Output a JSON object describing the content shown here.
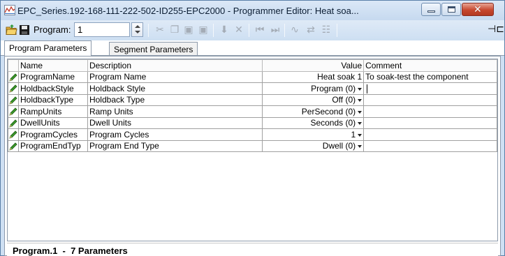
{
  "window": {
    "title": "EPC_Series.192-168-111-222-502-ID255-EPC2000 - Programmer Editor: Heat soa..."
  },
  "toolbar": {
    "program_label": "Program:",
    "program_value": "1",
    "icons": [
      "open-folder-icon",
      "save-icon",
      "cut-icon",
      "copy-icon",
      "paste-icon",
      "paste-special-icon",
      "insert-icon",
      "delete-icon",
      "first-icon",
      "last-icon",
      "graph-icon",
      "sync-icon",
      "table-icon",
      "pin-icon"
    ]
  },
  "tabs": [
    {
      "label": "Program Parameters",
      "active": true
    },
    {
      "label": "Segment Parameters",
      "active": false
    }
  ],
  "grid": {
    "columns": {
      "name": "Name",
      "description": "Description",
      "value": "Value",
      "comment": "Comment"
    },
    "rows": [
      {
        "name": "ProgramName",
        "description": "Program Name",
        "value": "Heat soak 1",
        "dropdown": false,
        "comment": "To soak-test the component"
      },
      {
        "name": "HoldbackStyle",
        "description": "Holdback Style",
        "value": "Program (0)",
        "dropdown": true,
        "comment": ""
      },
      {
        "name": "HoldbackType",
        "description": "Holdback Type",
        "value": "Off (0)",
        "dropdown": true,
        "comment": ""
      },
      {
        "name": "RampUnits",
        "description": "Ramp Units",
        "value": "PerSecond (0)",
        "dropdown": true,
        "comment": ""
      },
      {
        "name": "DwellUnits",
        "description": "Dwell Units",
        "value": "Seconds (0)",
        "dropdown": true,
        "comment": ""
      },
      {
        "name": "ProgramCycles",
        "description": "Program Cycles",
        "value": "1",
        "dropdown": true,
        "comment": ""
      },
      {
        "name": "ProgramEndTyp",
        "description": "Program End Type",
        "value": "Dwell (0)",
        "dropdown": true,
        "comment": ""
      }
    ]
  },
  "status": {
    "text": "Program.1  -  7 Parameters"
  },
  "colors": {
    "frame": "#cfe0f3",
    "close_button": "#c7482f",
    "pencil": "#3c9a2a"
  }
}
